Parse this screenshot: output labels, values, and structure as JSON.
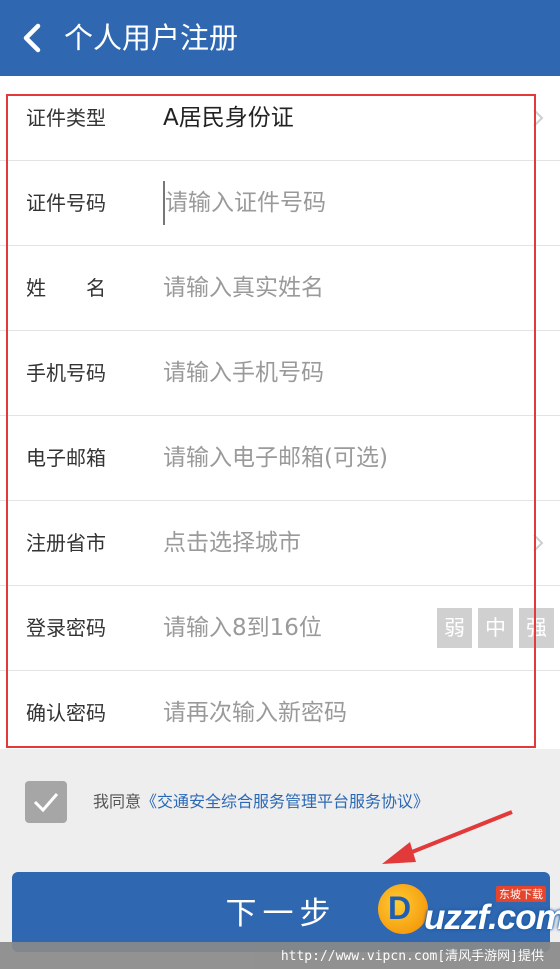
{
  "header": {
    "title": "个人用户注册",
    "back_icon": "chevron-left-icon"
  },
  "form": {
    "rows": [
      {
        "label": "证件类型",
        "value": "A居民身份证"
      },
      {
        "label": "证件号码",
        "placeholder": "请输入证件号码"
      },
      {
        "label": "姓　　名",
        "placeholder": "请输入真实姓名"
      },
      {
        "label": "手机号码",
        "placeholder": "请输入手机号码"
      },
      {
        "label": "电子邮箱",
        "placeholder": "请输入电子邮箱(可选)"
      },
      {
        "label": "注册省市",
        "value": "点击选择城市"
      },
      {
        "label": "登录密码",
        "placeholder": "请输入8到16位"
      },
      {
        "label": "确认密码",
        "placeholder": "请再次输入新密码"
      }
    ],
    "strength": [
      "弱",
      "中",
      "强"
    ]
  },
  "agreement": {
    "prefix": "我同意",
    "link": "《交通安全综合服务管理平台服务协议》"
  },
  "next_button": "下一步",
  "watermark": {
    "url": "http://www.vipcn.com[清风手游网]提供",
    "logo_word": "uzzf.com",
    "logo_sub": "东坡下载"
  },
  "colors": {
    "primary": "#2f68b0",
    "annotation": "#e23a3a",
    "link": "#2a68b5"
  }
}
